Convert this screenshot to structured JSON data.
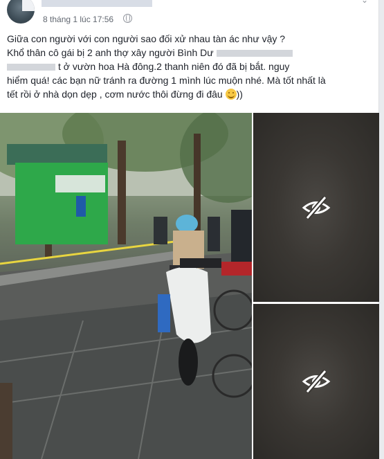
{
  "post": {
    "timestamp": "8 tháng 1 lúc 17:56",
    "icons": {
      "privacy": "globe-icon",
      "menu": "chevron-down-icon",
      "hidden_photo": "eye-slash-icon",
      "emoji": "smiling-face-icon"
    },
    "text": {
      "line1": "Giữa con người với con người sao đối xử nhau tàn ác như vậy ?",
      "line2_visible": "Khổ thân cô gái bị 2 anh thợ xây người Bình Dư",
      "line3_visible": "t ở vườn hoa Hà đông.2 thanh niên đó đã bị bắt. nguy",
      "line4": "hiểm quá! các bạn nữ tránh ra đường 1 mình lúc muộn nhé. Mà tốt nhất là",
      "line5": "tết rồi ở nhà dọn dẹp , cơm nước thôi đừng đi đâu",
      "line5_end": "))"
    },
    "photos": {
      "main_alt": "Street scene with public toilet kiosk, motorbike, police tape",
      "side_top_state": "hidden",
      "side_bottom_state": "hidden"
    },
    "colors": {
      "text": "#1d2129",
      "meta": "#616770",
      "kiosk_green": "#2ea84a"
    }
  }
}
